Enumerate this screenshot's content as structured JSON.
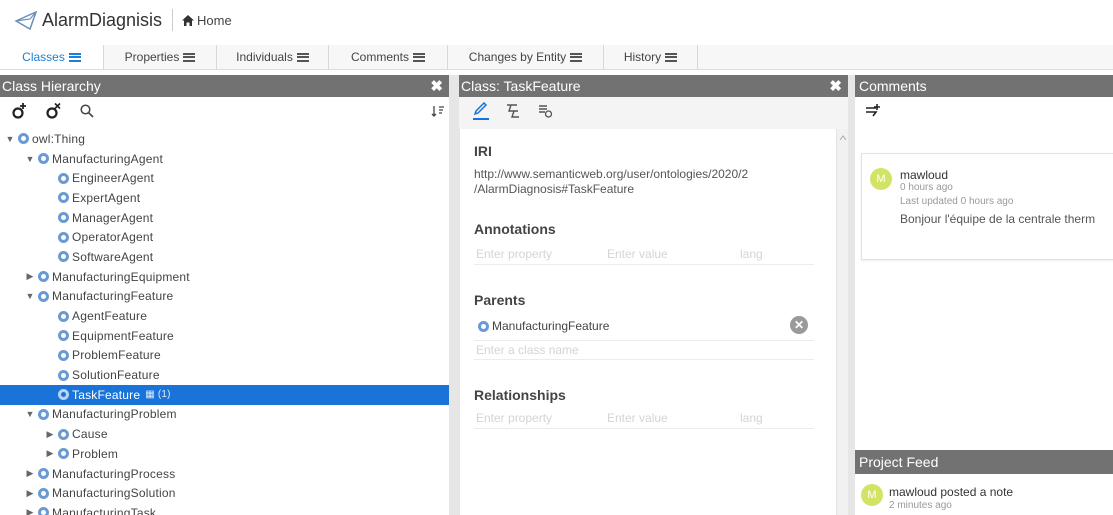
{
  "app": {
    "title": "AlarmDiagnisis",
    "home_label": "Home"
  },
  "tabs": [
    {
      "label": "Classes",
      "active": true
    },
    {
      "label": "Properties"
    },
    {
      "label": "Individuals"
    },
    {
      "label": "Comments"
    },
    {
      "label": "Changes by Entity"
    },
    {
      "label": "History"
    }
  ],
  "class_hierarchy": {
    "title": "Class Hierarchy",
    "items": [
      {
        "label": "owl:Thing",
        "level": 0,
        "expander": "expanded"
      },
      {
        "label": "ManufacturingAgent",
        "level": 1,
        "expander": "expanded"
      },
      {
        "label": "EngineerAgent",
        "level": 2,
        "expander": "none"
      },
      {
        "label": "ExpertAgent",
        "level": 2,
        "expander": "none"
      },
      {
        "label": "ManagerAgent",
        "level": 2,
        "expander": "none"
      },
      {
        "label": "OperatorAgent",
        "level": 2,
        "expander": "none"
      },
      {
        "label": "SoftwareAgent",
        "level": 2,
        "expander": "none"
      },
      {
        "label": "ManufacturingEquipment",
        "level": 1,
        "expander": "collapsed"
      },
      {
        "label": "ManufacturingFeature",
        "level": 1,
        "expander": "expanded"
      },
      {
        "label": "AgentFeature",
        "level": 2,
        "expander": "none"
      },
      {
        "label": "EquipmentFeature",
        "level": 2,
        "expander": "none"
      },
      {
        "label": "ProblemFeature",
        "level": 2,
        "expander": "none"
      },
      {
        "label": "SolutionFeature",
        "level": 2,
        "expander": "none"
      },
      {
        "label": "TaskFeature",
        "level": 2,
        "expander": "none",
        "selected": true,
        "badge": "(1)"
      },
      {
        "label": "ManufacturingProblem",
        "level": 1,
        "expander": "expanded"
      },
      {
        "label": "Cause",
        "level": 2,
        "expander": "collapsed"
      },
      {
        "label": "Problem",
        "level": 2,
        "expander": "collapsed"
      },
      {
        "label": "ManufacturingProcess",
        "level": 1,
        "expander": "collapsed"
      },
      {
        "label": "ManufacturingSolution",
        "level": 1,
        "expander": "collapsed"
      },
      {
        "label": "ManufacturingTask",
        "level": 1,
        "expander": "collapsed"
      }
    ]
  },
  "class_panel": {
    "title": "Class: TaskFeature",
    "iri_heading": "IRI",
    "iri_line1": "http://www.semanticweb.org/user/ontologies/2020/2",
    "iri_line2": "/AlarmDiagnosis#TaskFeature",
    "annotations_heading": "Annotations",
    "annotation_fields": {
      "property": "Enter property",
      "value": "Enter value",
      "lang": "lang"
    },
    "parents_heading": "Parents",
    "parent": "ManufacturingFeature",
    "parent_placeholder": "Enter a class name",
    "relationships_heading": "Relationships",
    "relationship_fields": {
      "property": "Enter property",
      "value": "Enter value",
      "lang": "lang"
    }
  },
  "comments_panel": {
    "title": "Comments",
    "comment": {
      "avatar": "M",
      "user": "mawloud",
      "time": "0 hours ago",
      "updated": "Last updated 0 hours ago",
      "body": "Bonjour l'équipe de la centrale therm"
    }
  },
  "project_feed": {
    "title": "Project Feed",
    "avatar": "M",
    "entry": "mawloud posted a note",
    "time": "2 minutes ago"
  },
  "colors": {
    "accent": "#1a73d8",
    "panel_header": "#727272",
    "class_icon": "#6a9ad4",
    "avatar": "#d2e366"
  }
}
